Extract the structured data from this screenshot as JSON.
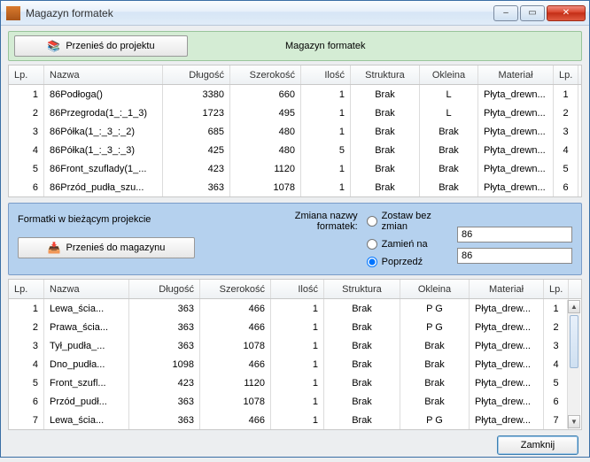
{
  "window": {
    "title": "Magazyn formatek"
  },
  "topPanel": {
    "button": "Przenieś do projektu",
    "label": "Magazyn formatek"
  },
  "grid1": {
    "columns": [
      "Lp.",
      "Nazwa",
      "Długość",
      "Szerokość",
      "Ilość",
      "Struktura",
      "Okleina",
      "Materiał",
      "Lp."
    ],
    "rows": [
      {
        "lp": "1",
        "nazwa": "86Podłoga()",
        "dlug": "3380",
        "szer": "660",
        "ilosc": "1",
        "struk": "Brak",
        "okl": "L",
        "mat": "Płyta_drewn...",
        "lp2": "1"
      },
      {
        "lp": "2",
        "nazwa": "86Przegroda(1_:_1_3)",
        "dlug": "1723",
        "szer": "495",
        "ilosc": "1",
        "struk": "Brak",
        "okl": "L",
        "mat": "Płyta_drewn...",
        "lp2": "2"
      },
      {
        "lp": "3",
        "nazwa": "86Półka(1_:_3_:_2)",
        "dlug": "685",
        "szer": "480",
        "ilosc": "1",
        "struk": "Brak",
        "okl": "Brak",
        "mat": "Płyta_drewn...",
        "lp2": "3"
      },
      {
        "lp": "4",
        "nazwa": "86Półka(1_:_3_:_3)",
        "dlug": "425",
        "szer": "480",
        "ilosc": "5",
        "struk": "Brak",
        "okl": "Brak",
        "mat": "Płyta_drewn...",
        "lp2": "4"
      },
      {
        "lp": "5",
        "nazwa": "86Front_szuflady(1_...",
        "dlug": "423",
        "szer": "1120",
        "ilosc": "1",
        "struk": "Brak",
        "okl": "Brak",
        "mat": "Płyta_drewn...",
        "lp2": "5"
      },
      {
        "lp": "6",
        "nazwa": "86Przód_pudła_szu...",
        "dlug": "363",
        "szer": "1078",
        "ilosc": "1",
        "struk": "Brak",
        "okl": "Brak",
        "mat": "Płyta_drewn...",
        "lp2": "6"
      }
    ]
  },
  "midPanel": {
    "leftLabel": "Formatki w bieżącym projekcie",
    "button": "Przenieś do magazynu",
    "changeLabel": "Zmiana nazwy formatek:",
    "opt1": "Zostaw bez zmian",
    "opt2": "Zamień na",
    "opt3": "Poprzedź",
    "selected": "opt3",
    "field1": "86",
    "field2": "86"
  },
  "grid2": {
    "columns": [
      "Lp.",
      "Nazwa",
      "Długość",
      "Szerokość",
      "Ilość",
      "Struktura",
      "Okleina",
      "Materiał",
      "Lp."
    ],
    "rows": [
      {
        "lp": "1",
        "nazwa": "Lewa_ścia...",
        "dlug": "363",
        "szer": "466",
        "ilosc": "1",
        "struk": "Brak",
        "okl": "P G",
        "mat": "Płyta_drew...",
        "lp2": "1"
      },
      {
        "lp": "2",
        "nazwa": "Prawa_ścia...",
        "dlug": "363",
        "szer": "466",
        "ilosc": "1",
        "struk": "Brak",
        "okl": "P G",
        "mat": "Płyta_drew...",
        "lp2": "2"
      },
      {
        "lp": "3",
        "nazwa": "Tył_pudła_...",
        "dlug": "363",
        "szer": "1078",
        "ilosc": "1",
        "struk": "Brak",
        "okl": "Brak",
        "mat": "Płyta_drew...",
        "lp2": "3"
      },
      {
        "lp": "4",
        "nazwa": "Dno_pudła...",
        "dlug": "1098",
        "szer": "466",
        "ilosc": "1",
        "struk": "Brak",
        "okl": "Brak",
        "mat": "Płyta_drew...",
        "lp2": "4"
      },
      {
        "lp": "5",
        "nazwa": "Front_szufl...",
        "dlug": "423",
        "szer": "1120",
        "ilosc": "1",
        "struk": "Brak",
        "okl": "Brak",
        "mat": "Płyta_drew...",
        "lp2": "5"
      },
      {
        "lp": "6",
        "nazwa": "Przód_pudł...",
        "dlug": "363",
        "szer": "1078",
        "ilosc": "1",
        "struk": "Brak",
        "okl": "Brak",
        "mat": "Płyta_drew...",
        "lp2": "6"
      },
      {
        "lp": "7",
        "nazwa": "Lewa_ścia...",
        "dlug": "363",
        "szer": "466",
        "ilosc": "1",
        "struk": "Brak",
        "okl": "P G",
        "mat": "Płyta_drew...",
        "lp2": "7"
      }
    ]
  },
  "bottom": {
    "close": "Zamknij"
  }
}
